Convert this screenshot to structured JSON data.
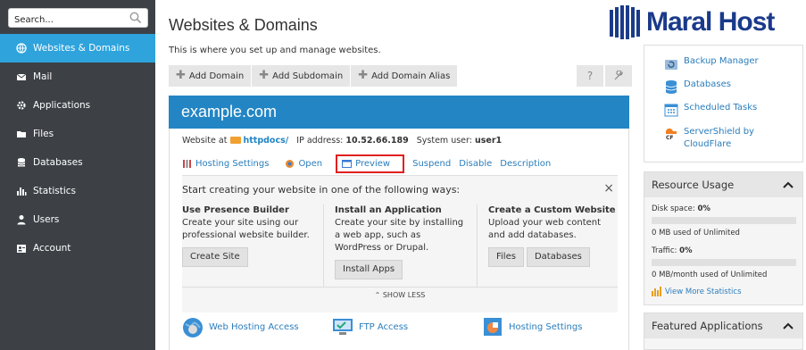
{
  "sidebar": {
    "search_placeholder": "Search...",
    "items": [
      {
        "label": "Websites & Domains",
        "icon": "globe-icon",
        "active": true
      },
      {
        "label": "Mail",
        "icon": "mail-icon"
      },
      {
        "label": "Applications",
        "icon": "gear-icon"
      },
      {
        "label": "Files",
        "icon": "files-icon"
      },
      {
        "label": "Databases",
        "icon": "database-icon"
      },
      {
        "label": "Statistics",
        "icon": "statistics-icon"
      },
      {
        "label": "Users",
        "icon": "user-icon"
      },
      {
        "label": "Account",
        "icon": "account-icon"
      }
    ]
  },
  "header": {
    "title": "Websites & Domains",
    "subtitle": "This is where you set up and manage websites.",
    "logo": "Maral Host"
  },
  "toolbar": {
    "add_domain": "Add Domain",
    "add_subdomain": "Add Subdomain",
    "add_domain_alias": "Add Domain Alias",
    "help": "?"
  },
  "domain": {
    "name": "example.com",
    "website_at_label": "Website at",
    "docroot": "httpdocs/",
    "ip_label": "IP address:",
    "ip": "10.52.66.189",
    "system_user_label": "System user:",
    "system_user": "user1",
    "actions": {
      "hosting_settings": "Hosting Settings",
      "open": "Open",
      "preview": "Preview",
      "suspend": "Suspend",
      "disable": "Disable",
      "description": "Description"
    }
  },
  "start": {
    "title": "Start creating your website in one of the following ways:",
    "close": "×",
    "columns": [
      {
        "heading": "Use Presence Builder",
        "text": "Create your site using our professional website builder.",
        "buttons": [
          "Create Site"
        ]
      },
      {
        "heading": "Install an Application",
        "text": "Create your site by installing a web app, such as WordPress or Drupal.",
        "buttons": [
          "Install Apps"
        ]
      },
      {
        "heading": "Create a Custom Website",
        "text": "Upload your web content and add databases.",
        "buttons": [
          "Files",
          "Databases"
        ]
      }
    ],
    "show_less": "⌃ SHOW LESS"
  },
  "bottom_links": [
    "Web Hosting Access",
    "FTP Access",
    "Hosting Settings"
  ],
  "right": {
    "links": [
      "Backup Manager",
      "Databases",
      "Scheduled Tasks",
      "ServerShield by CloudFlare"
    ],
    "resource_usage": {
      "title": "Resource Usage",
      "disk_label": "Disk space:",
      "disk_value": "0%",
      "disk_used": "0 MB used of Unlimited",
      "disk_fraction": 0,
      "traffic_label": "Traffic:",
      "traffic_value": "0%",
      "traffic_used": "0 MB/month used of Unlimited",
      "traffic_fraction": 0,
      "more": "View More Statistics"
    },
    "featured": {
      "title": "Featured Applications"
    }
  },
  "colors": {
    "sidebar_bg": "#3d4146",
    "accent": "#2ea3dc",
    "domain_header": "#2385c4",
    "link": "#2a7dbc",
    "highlight_box": "#e02020"
  }
}
